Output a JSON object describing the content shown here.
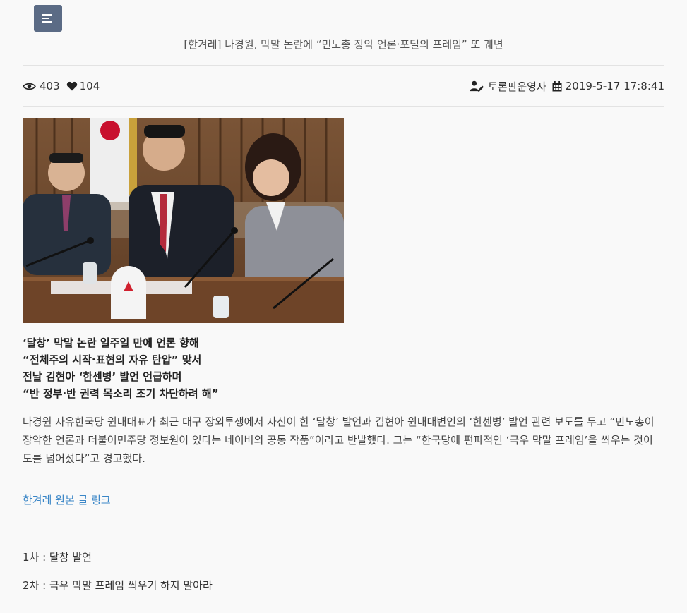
{
  "header": {
    "menu_icon": "hamburger-menu-icon",
    "title": "[한겨레] 나경원, 막말 논란에 “민노총 장악 언론·포털의 프레임” 또 궤변"
  },
  "meta": {
    "views": "403",
    "likes": "104",
    "author": "토론판운영자",
    "date": "2019-5-17 17:8:41",
    "icons": [
      "eye-icon",
      "heart-icon",
      "user-edit-icon",
      "calendar-icon"
    ]
  },
  "article": {
    "subheadings": [
      "‘달창’ 막말 논란 일주일 만에 언론 향해",
      "“전체주의 시작·표현의 자유 탄압” 맞서",
      "전날 김현아 ‘한센병’ 발언 언급하며",
      "“반 정부·반 권력 목소리 조기 차단하려 해”"
    ],
    "body": "나경원 자유한국당 원내대표가 최근 대구 장외투쟁에서 자신이 한 ‘달창’ 발언과 김현아 원내대변인의 ‘한센병’ 발언 관련 보도를 두고 “민노총이 장악한 언론과 더불어민주당 정보원이 있다는 네이버의 공동 작품”이라고 반발했다. 그는 “한국당에 편파적인 ‘극우 막말 프레임’을 씌우는 것이 도를 넘어섰다”고 경고했다.",
    "link_label": "한겨레 원본 글 링크",
    "notes": [
      "1차 : 달창 발언",
      "2차 : 극우 막말 프레임 씌우기 하지 말아라"
    ]
  },
  "colors": {
    "menu_bg": "#5b6b85",
    "link": "#3a86c7",
    "background": "#f9f9f9"
  }
}
